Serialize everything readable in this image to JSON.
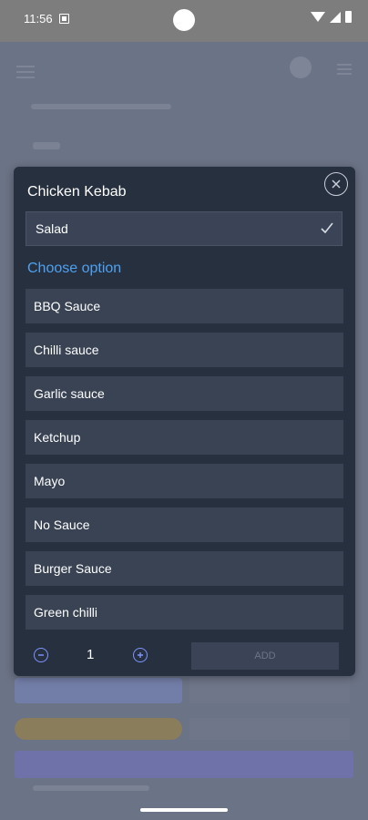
{
  "status_bar": {
    "time": "11:56"
  },
  "modal": {
    "title": "Chicken Kebab",
    "selected_option": "Salad",
    "choose_label": "Choose option",
    "options": [
      "BBQ Sauce",
      "Chilli sauce",
      "Garlic sauce",
      "Ketchup",
      "Mayo",
      "No Sauce",
      "Burger Sauce",
      "Green chilli"
    ],
    "quantity": "1",
    "add_label": "ADD"
  },
  "colors": {
    "modal_bg": "#27303f",
    "option_bg": "#394354",
    "accent_link": "#4ea1f0",
    "stepper_accent": "#7e94ff",
    "overlay": "#6b7386"
  },
  "icons": {
    "close": "close-icon",
    "check": "check-icon",
    "minus": "minus-icon",
    "plus": "plus-icon"
  }
}
